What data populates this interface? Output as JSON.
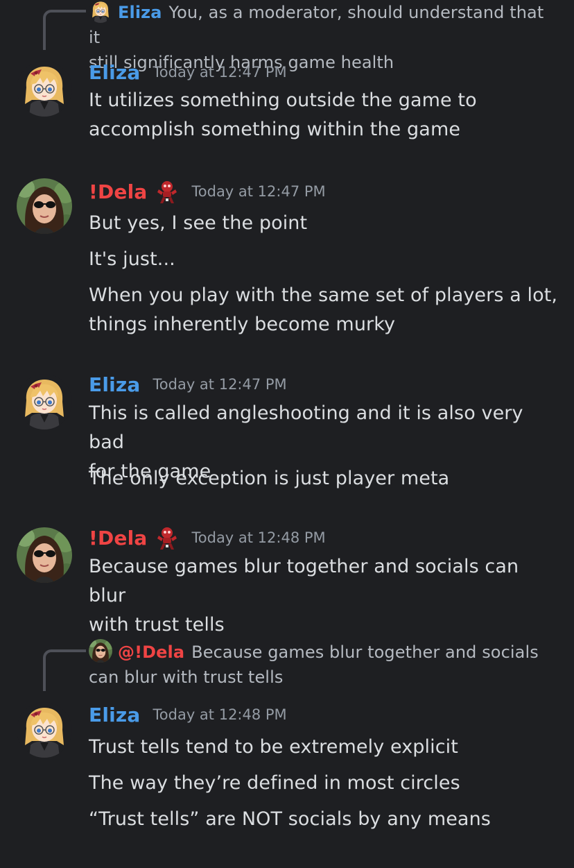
{
  "colors": {
    "background": "#1e1f22",
    "eliza_name": "#4a9be8",
    "dela_name": "#ef4444",
    "text": "#dbdee1",
    "muted": "#949ba4"
  },
  "replies": [
    {
      "author": "Eliza",
      "text": "You, as a moderator, should understand that it",
      "text_cont": "still significantly harms game health",
      "avatar_icon": "eliza-avatar-icon"
    },
    {
      "author": "@!Dela",
      "text": "Because games blur together and socials",
      "text_cont": "can blur with trust tells",
      "avatar_icon": "dela-avatar-icon"
    }
  ],
  "groups": [
    {
      "author": "Eliza",
      "timestamp": "Today at 12:47 PM",
      "lines": [
        "It utilizes something outside the game to",
        "accomplish something within the game"
      ]
    },
    {
      "author": "!Dela",
      "timestamp": "Today at 12:47 PM",
      "role_icon": "red-robot-role-icon",
      "lines": [
        "But yes, I see the point",
        "It's just...",
        "When you play with the same set of players a lot,",
        "things inherently become murky"
      ]
    },
    {
      "author": "Eliza",
      "timestamp": "Today at 12:47 PM",
      "lines": [
        "This is called angleshooting and it is also very bad",
        "for the game",
        "The only exception is just player meta"
      ]
    },
    {
      "author": "!Dela",
      "timestamp": "Today at 12:48 PM",
      "role_icon": "red-robot-role-icon",
      "lines": [
        "Because games blur together and socials can blur",
        "with trust tells"
      ]
    },
    {
      "author": "Eliza",
      "timestamp": "Today at 12:48 PM",
      "lines": [
        "Trust tells tend to be extremely explicit",
        "The way they’re defined in most circles",
        "“Trust tells” are NOT socials by any means"
      ]
    }
  ]
}
